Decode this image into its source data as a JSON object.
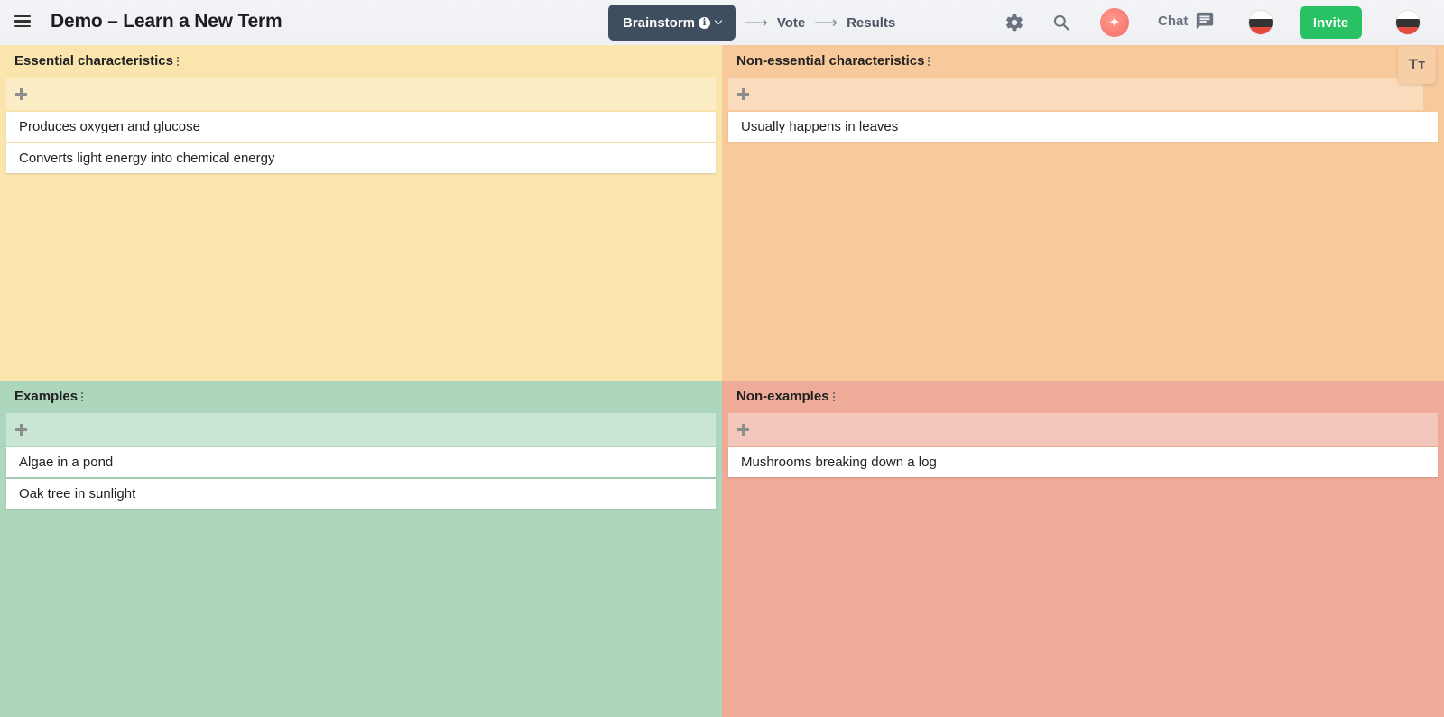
{
  "header": {
    "title": "Demo – Learn a New Term",
    "stages": [
      {
        "label": "Brainstorm",
        "active": true
      },
      {
        "label": "Vote",
        "active": false
      },
      {
        "label": "Results",
        "active": false
      }
    ],
    "info_glyph": "i",
    "ai_glyph": "✦",
    "chat_label": "Chat",
    "invite_label": "Invite",
    "text_size_glyph": "Tт",
    "icons": [
      "menu-icon",
      "info-icon",
      "chevron-down-icon",
      "arrow-right-icon",
      "gear-icon",
      "search-icon",
      "sparkle-icon",
      "chat-bubble-icon",
      "text-size-icon"
    ],
    "colors": {
      "active_stage": "#3f4e5f",
      "invite": "#28c265",
      "ai": "#f36b6b"
    }
  },
  "quadrants": {
    "essential": {
      "title": "Essential characteristics",
      "color": "#fae5ad",
      "cards": [
        "Produces oxygen and glucose",
        "Converts light energy into chemical energy"
      ]
    },
    "nonessential": {
      "title": "Non-essential characteristics",
      "color": "#f8c99b",
      "cards": [
        "Usually happens in leaves"
      ]
    },
    "examples": {
      "title": "Examples",
      "color": "#acd7bd",
      "cards": [
        "Algae in a pond",
        "Oak tree in sunlight"
      ]
    },
    "nonexamples": {
      "title": "Non-examples",
      "color": "#eeab98",
      "cards": [
        "Mushrooms breaking down a log"
      ]
    }
  }
}
